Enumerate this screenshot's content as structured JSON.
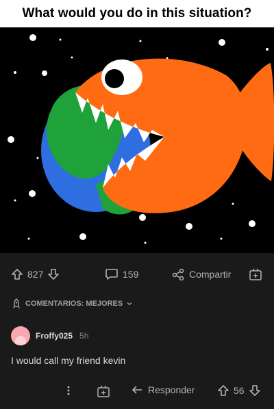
{
  "post": {
    "title": "What would you do in this situation?",
    "image": {
      "description_icon": "fish-eating-earth-image",
      "background": "#000000",
      "fish_color": "#ff6b12",
      "land_color": "#1fa23a",
      "ocean_color": "#2e6ee0"
    }
  },
  "action_bar": {
    "upvotes": "827",
    "comments": "159",
    "share_label": "Compartir"
  },
  "comments_sort": {
    "label": "COMENTARIOS: MEJORES"
  },
  "comment": {
    "author": "Froffy025",
    "age": "5h",
    "body": "I would call my friend kevin",
    "reply_label": "Responder",
    "votes": "56"
  },
  "colors": {
    "background": "#1a1a1b",
    "text": "#d7dadc",
    "muted": "#b0b3b8"
  }
}
